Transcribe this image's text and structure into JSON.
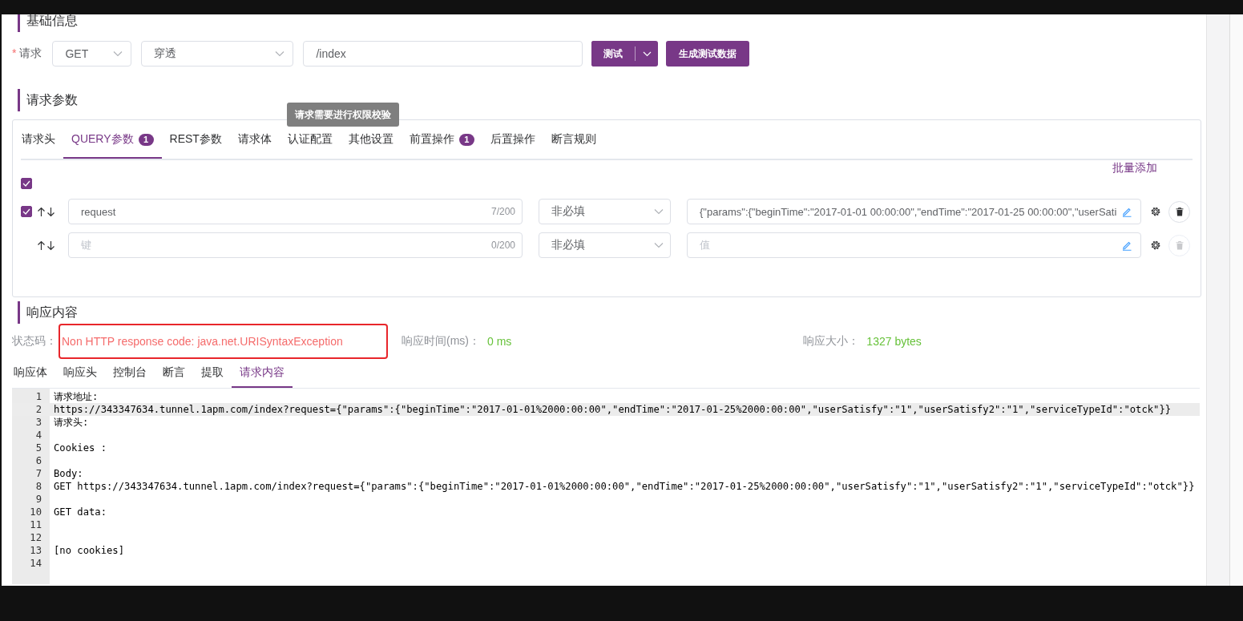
{
  "basic": {
    "title": "基础信息",
    "request_label": "请求",
    "required_mark": "*",
    "method": "GET",
    "environment": "穿透",
    "path": "/index",
    "test_button": "测试",
    "generate_button": "生成测试数据"
  },
  "params": {
    "title": "请求参数",
    "tooltip": "请求需要进行权限校验",
    "tabs": [
      {
        "label": "请求头",
        "selected": false
      },
      {
        "label": "QUERY参数",
        "selected": true,
        "badge": "1"
      },
      {
        "label": "REST参数",
        "selected": false
      },
      {
        "label": "请求体",
        "selected": false
      },
      {
        "label": "认证配置",
        "selected": false
      },
      {
        "label": "其他设置",
        "selected": false
      },
      {
        "label": "前置操作",
        "selected": false,
        "badge": "1"
      },
      {
        "label": "后置操作",
        "selected": false
      },
      {
        "label": "断言规则",
        "selected": false
      }
    ],
    "batch_add": "批量添加",
    "select_all_checked": true,
    "rows": [
      {
        "kind": "item",
        "checked": true,
        "key": "request",
        "key_count": "7/200",
        "required": "非必填",
        "value": "{\"params\":{\"beginTime\":\"2017-01-01 00:00:00\",\"endTime\":\"2017-01-25 00:00:00\",\"userSati",
        "delete_disabled": false
      },
      {
        "kind": "new",
        "key_placeholder": "键",
        "key_count": "0/200",
        "required": "非必填",
        "value_placeholder": "值",
        "delete_disabled": true
      }
    ]
  },
  "response": {
    "title": "响应内容",
    "status_label": "状态码：",
    "status": "Non HTTP response code: java.net.URISyntaxException",
    "status_highlighted": true,
    "time_label": "响应时间(ms)：",
    "time": "0 ms",
    "size_label": "响应大小：",
    "size": "1327 bytes",
    "tabs": [
      {
        "label": "响应体",
        "selected": false
      },
      {
        "label": "响应头",
        "selected": false
      },
      {
        "label": "控制台",
        "selected": false
      },
      {
        "label": "断言",
        "selected": false
      },
      {
        "label": "提取",
        "selected": false
      },
      {
        "label": "请求内容",
        "selected": true
      }
    ],
    "editor": {
      "lines": [
        {
          "number": "1",
          "text": "请求地址:",
          "current": false
        },
        {
          "number": "2",
          "text": "https://343347634.tunnel.1apm.com/index?request={\"params\":{\"beginTime\":\"2017-01-01%2000:00:00\",\"endTime\":\"2017-01-25%2000:00:00\",\"userSatisfy\":\"1\",\"userSatisfy2\":\"1\",\"serviceTypeId\":\"otck\"}}",
          "current": true
        },
        {
          "number": "3",
          "text": "请求头:",
          "current": false
        },
        {
          "number": "4",
          "current": false
        },
        {
          "number": "5",
          "text": "Cookies :",
          "current": false
        },
        {
          "number": "6",
          "current": false
        },
        {
          "number": "7",
          "text": "Body:",
          "current": false
        },
        {
          "number": "8",
          "text": "GET https://343347634.tunnel.1apm.com/index?request={\"params\":{\"beginTime\":\"2017-01-01%2000:00:00\",\"endTime\":\"2017-01-25%2000:00:00\",\"userSatisfy\":\"1\",\"userSatisfy2\":\"1\",\"serviceTypeId\":\"otck\"}}",
          "current": false
        },
        {
          "number": "9",
          "current": false
        },
        {
          "number": "10",
          "text": "GET data:",
          "current": false
        },
        {
          "number": "11",
          "current": false
        },
        {
          "number": "12",
          "current": false
        },
        {
          "number": "13",
          "text": "[no cookies]",
          "current": false
        },
        {
          "number": "14",
          "current": false
        }
      ]
    }
  }
}
